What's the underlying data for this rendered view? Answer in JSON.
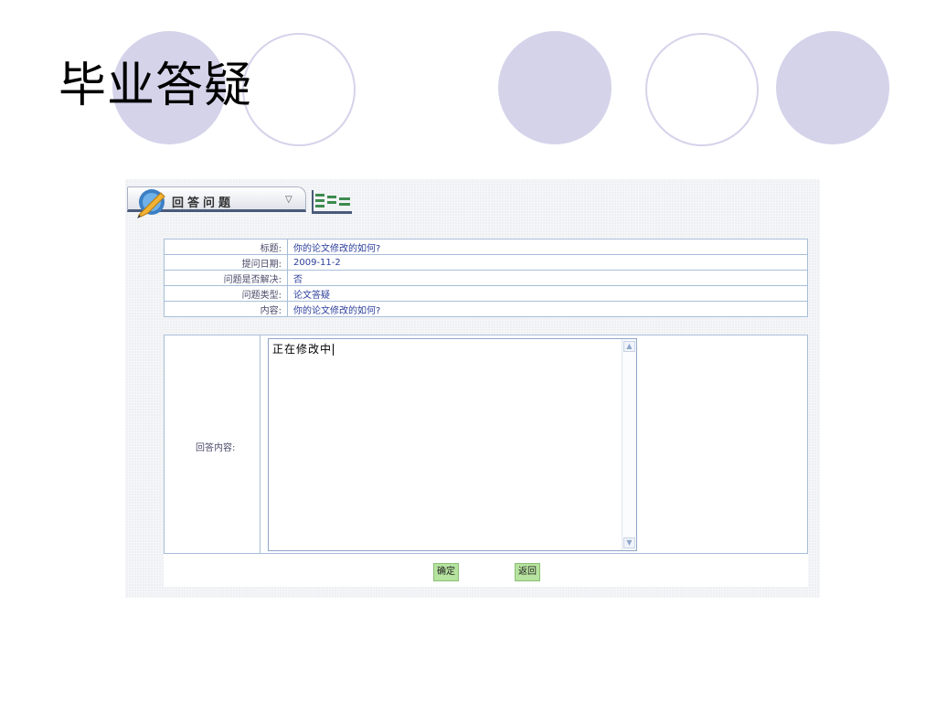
{
  "slide": {
    "title": "毕业答疑",
    "decor_color": "#d5d3ea"
  },
  "panel": {
    "tab_label": "回答问题",
    "tab_arrow": "▽"
  },
  "info": {
    "rows": [
      {
        "key": "标题:",
        "value": "你的论文修改的如何?"
      },
      {
        "key": "提问日期:",
        "value": "2009-11-2"
      },
      {
        "key": "问题是否解决:",
        "value": "否"
      },
      {
        "key": "问题类型:",
        "value": "论文答疑"
      },
      {
        "key": "内容:",
        "value": "你的论文修改的如何?"
      }
    ]
  },
  "answer": {
    "label": "回答内容:",
    "text": "正在修改中"
  },
  "buttons": {
    "confirm": "确定",
    "back": "返回",
    "color": "#b6e39f"
  }
}
